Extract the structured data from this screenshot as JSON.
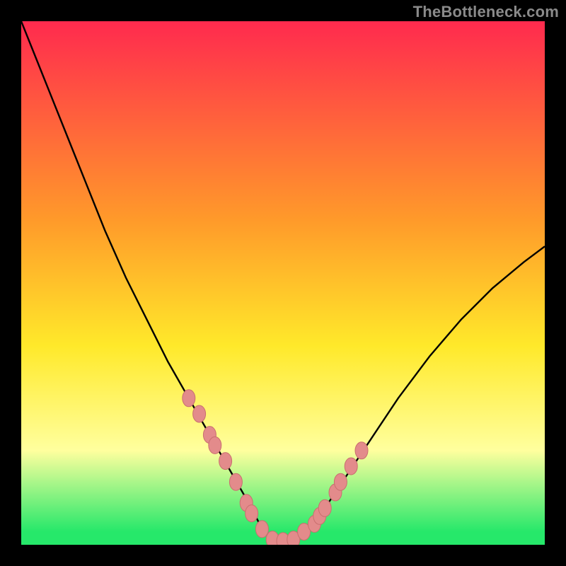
{
  "watermark": "TheBottleneck.com",
  "colors": {
    "bg_black": "#000000",
    "gradient_top": "#ff2a4e",
    "gradient_mid1": "#ff9a2a",
    "gradient_mid2": "#ffe92a",
    "gradient_band": "#ffff9e",
    "gradient_bottom": "#26e86a",
    "curve": "#000000",
    "marker_fill": "#e38b8b",
    "marker_stroke": "#c96f6f"
  },
  "chart_data": {
    "type": "line",
    "title": "",
    "xlabel": "",
    "ylabel": "",
    "xlim": [
      0,
      100
    ],
    "ylim": [
      0,
      100
    ],
    "series": [
      {
        "name": "bottleneck-curve",
        "x": [
          0,
          4,
          8,
          12,
          16,
          20,
          24,
          28,
          32,
          36,
          40,
          44,
          46,
          48,
          50,
          52,
          56,
          60,
          66,
          72,
          78,
          84,
          90,
          96,
          100
        ],
        "y": [
          100,
          90,
          80,
          70,
          60,
          51,
          43,
          35,
          28,
          21,
          14,
          7,
          3,
          1,
          0.5,
          1,
          4,
          10,
          19,
          28,
          36,
          43,
          49,
          54,
          57
        ]
      }
    ],
    "markers": {
      "name": "highlighted-points",
      "x": [
        32,
        34,
        36,
        37,
        39,
        41,
        43,
        44,
        46,
        48,
        50,
        52,
        54,
        56,
        57,
        58,
        60,
        61,
        63,
        65
      ],
      "y": [
        28,
        25,
        21,
        19,
        16,
        12,
        8,
        6,
        3,
        1,
        0.7,
        1,
        2.5,
        4,
        5.5,
        7,
        10,
        12,
        15,
        18
      ]
    },
    "background_gradient_stops": [
      {
        "offset": 0.0,
        "color": "#ff2a4e"
      },
      {
        "offset": 0.38,
        "color": "#ff9a2a"
      },
      {
        "offset": 0.62,
        "color": "#ffe92a"
      },
      {
        "offset": 0.82,
        "color": "#ffff9e"
      },
      {
        "offset": 0.975,
        "color": "#26e86a"
      }
    ]
  }
}
